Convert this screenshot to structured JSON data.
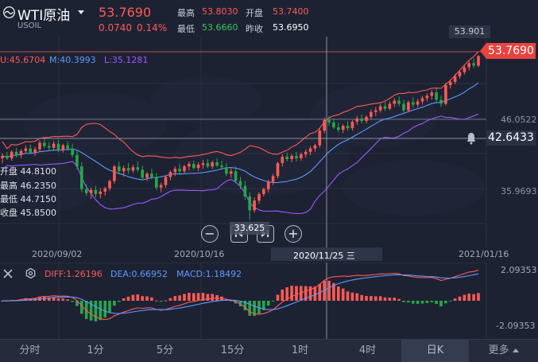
{
  "header": {
    "symbol": "WTI原油",
    "symbol_code": "USOIL",
    "last_price": "53.7690",
    "change": "0.0740",
    "change_pct": "0.14%",
    "high_label": "最高",
    "high_value": "53.8030",
    "open_label": "开盘",
    "open_value": "53.7400",
    "low_label": "最低",
    "low_value": "53.6660",
    "prev_close_label": "昨收",
    "prev_close_value": "53.6950"
  },
  "indicators": {
    "up": "U:45.6704",
    "mid": "M:40.3993",
    "low": "L:35.1281"
  },
  "ohlc_overlay": {
    "open": "开盘 44.8100",
    "high": "最高 46.2350",
    "low": "最低 44.7150",
    "close": "收盘 45.8500"
  },
  "price_axis": {
    "high_mark": "53.901",
    "current_price_tag": "53.7690",
    "level_1": "46.0522",
    "crosshair_value": "42.6433",
    "level_2": "35.9693",
    "low_mark": "33.625"
  },
  "x_axis": {
    "labels": [
      "2020/09/02",
      "2020/10/16",
      "2021/01/16"
    ],
    "crosshair_label": "2020/11/25 三"
  },
  "macd": {
    "diff": "DIFF:1.26196",
    "dea": "DEA:0.66952",
    "macd": "MACD:1.18492",
    "y_top": "2.09353",
    "y_bottom": "-2.09353"
  },
  "tabs": [
    "分时",
    "1分",
    "5分",
    "15分",
    "1时",
    "4时",
    "日K",
    "更多"
  ],
  "active_tab": "日K",
  "colors": {
    "up": "#ff5a55",
    "down": "#26a84a",
    "background": "#1d2233",
    "boll_mid": "#5b9bff",
    "boll_up": "#ff5a55",
    "boll_low": "#9b59ff"
  },
  "icons": {
    "symbol": "wave-icon",
    "close": "close-icon",
    "settings": "settings-icon",
    "alert": "bell-icon"
  },
  "chart_data": {
    "type": "candlestick",
    "price_range": [
      31.5,
      55.0
    ],
    "candles": [
      {
        "o": 41.2,
        "h": 41.8,
        "l": 40.6,
        "c": 41.5
      },
      {
        "o": 41.5,
        "h": 42.0,
        "l": 41.0,
        "c": 41.2
      },
      {
        "o": 41.2,
        "h": 42.2,
        "l": 40.9,
        "c": 42.0
      },
      {
        "o": 42.0,
        "h": 42.5,
        "l": 41.3,
        "c": 41.6
      },
      {
        "o": 41.6,
        "h": 42.3,
        "l": 41.2,
        "c": 42.1
      },
      {
        "o": 42.1,
        "h": 42.8,
        "l": 41.8,
        "c": 42.4
      },
      {
        "o": 42.4,
        "h": 42.9,
        "l": 41.7,
        "c": 41.9
      },
      {
        "o": 41.9,
        "h": 42.6,
        "l": 41.5,
        "c": 42.3
      },
      {
        "o": 42.3,
        "h": 43.4,
        "l": 42.0,
        "c": 43.1
      },
      {
        "o": 43.1,
        "h": 43.6,
        "l": 42.4,
        "c": 42.7
      },
      {
        "o": 42.7,
        "h": 43.2,
        "l": 42.1,
        "c": 42.5
      },
      {
        "o": 42.5,
        "h": 43.3,
        "l": 42.2,
        "c": 43.0
      },
      {
        "o": 43.0,
        "h": 43.5,
        "l": 42.0,
        "c": 42.2
      },
      {
        "o": 42.2,
        "h": 43.0,
        "l": 41.9,
        "c": 42.8
      },
      {
        "o": 42.8,
        "h": 43.3,
        "l": 42.1,
        "c": 42.4
      },
      {
        "o": 42.4,
        "h": 43.0,
        "l": 41.3,
        "c": 41.6
      },
      {
        "o": 41.6,
        "h": 42.1,
        "l": 39.8,
        "c": 40.2
      },
      {
        "o": 40.2,
        "h": 40.7,
        "l": 37.0,
        "c": 37.4
      },
      {
        "o": 37.4,
        "h": 38.0,
        "l": 36.6,
        "c": 36.9
      },
      {
        "o": 36.9,
        "h": 37.6,
        "l": 36.2,
        "c": 37.3
      },
      {
        "o": 37.3,
        "h": 37.8,
        "l": 36.4,
        "c": 36.8
      },
      {
        "o": 36.8,
        "h": 37.5,
        "l": 36.3,
        "c": 37.1
      },
      {
        "o": 37.1,
        "h": 37.7,
        "l": 36.6,
        "c": 37.5
      },
      {
        "o": 37.5,
        "h": 38.6,
        "l": 37.2,
        "c": 38.4
      },
      {
        "o": 38.4,
        "h": 40.4,
        "l": 38.1,
        "c": 40.2
      },
      {
        "o": 40.2,
        "h": 40.8,
        "l": 39.2,
        "c": 39.6
      },
      {
        "o": 39.6,
        "h": 40.3,
        "l": 38.9,
        "c": 40.0
      },
      {
        "o": 40.0,
        "h": 40.6,
        "l": 39.3,
        "c": 39.7
      },
      {
        "o": 39.7,
        "h": 40.4,
        "l": 39.4,
        "c": 40.1
      },
      {
        "o": 40.1,
        "h": 40.8,
        "l": 39.5,
        "c": 39.8
      },
      {
        "o": 39.8,
        "h": 40.3,
        "l": 38.5,
        "c": 38.8
      },
      {
        "o": 38.8,
        "h": 39.5,
        "l": 38.4,
        "c": 39.3
      },
      {
        "o": 39.3,
        "h": 39.9,
        "l": 38.6,
        "c": 38.9
      },
      {
        "o": 38.9,
        "h": 39.4,
        "l": 37.3,
        "c": 37.6
      },
      {
        "o": 37.6,
        "h": 38.2,
        "l": 37.0,
        "c": 37.9
      },
      {
        "o": 37.9,
        "h": 39.1,
        "l": 37.6,
        "c": 38.9
      },
      {
        "o": 38.9,
        "h": 39.7,
        "l": 38.5,
        "c": 39.5
      },
      {
        "o": 39.5,
        "h": 40.2,
        "l": 39.0,
        "c": 39.9
      },
      {
        "o": 39.9,
        "h": 40.5,
        "l": 39.3,
        "c": 39.6
      },
      {
        "o": 39.6,
        "h": 40.4,
        "l": 39.4,
        "c": 40.2
      },
      {
        "o": 40.2,
        "h": 40.8,
        "l": 39.7,
        "c": 40.5
      },
      {
        "o": 40.5,
        "h": 40.9,
        "l": 39.8,
        "c": 40.0
      },
      {
        "o": 40.0,
        "h": 40.7,
        "l": 39.6,
        "c": 40.4
      },
      {
        "o": 40.4,
        "h": 41.0,
        "l": 39.9,
        "c": 40.6
      },
      {
        "o": 40.6,
        "h": 41.1,
        "l": 40.0,
        "c": 40.2
      },
      {
        "o": 40.2,
        "h": 40.9,
        "l": 39.9,
        "c": 40.7
      },
      {
        "o": 40.7,
        "h": 41.2,
        "l": 40.1,
        "c": 40.3
      },
      {
        "o": 40.3,
        "h": 40.9,
        "l": 39.8,
        "c": 40.1
      },
      {
        "o": 40.1,
        "h": 40.6,
        "l": 39.0,
        "c": 39.3
      },
      {
        "o": 39.3,
        "h": 40.0,
        "l": 38.8,
        "c": 39.6
      },
      {
        "o": 39.6,
        "h": 40.2,
        "l": 38.1,
        "c": 38.4
      },
      {
        "o": 38.4,
        "h": 38.9,
        "l": 37.4,
        "c": 37.8
      },
      {
        "o": 37.8,
        "h": 38.4,
        "l": 36.1,
        "c": 36.5
      },
      {
        "o": 36.5,
        "h": 37.0,
        "l": 33.6,
        "c": 34.8
      },
      {
        "o": 34.8,
        "h": 36.4,
        "l": 34.5,
        "c": 36.0
      },
      {
        "o": 36.0,
        "h": 37.0,
        "l": 35.6,
        "c": 36.8
      },
      {
        "o": 36.8,
        "h": 37.6,
        "l": 36.5,
        "c": 37.4
      },
      {
        "o": 37.4,
        "h": 38.6,
        "l": 37.0,
        "c": 38.3
      },
      {
        "o": 38.3,
        "h": 39.3,
        "l": 37.9,
        "c": 39.0
      },
      {
        "o": 39.0,
        "h": 40.8,
        "l": 38.7,
        "c": 40.6
      },
      {
        "o": 40.6,
        "h": 41.7,
        "l": 40.2,
        "c": 41.4
      },
      {
        "o": 41.4,
        "h": 41.9,
        "l": 40.8,
        "c": 41.1
      },
      {
        "o": 41.1,
        "h": 41.7,
        "l": 40.7,
        "c": 41.5
      },
      {
        "o": 41.5,
        "h": 42.0,
        "l": 40.8,
        "c": 41.2
      },
      {
        "o": 41.2,
        "h": 41.9,
        "l": 40.9,
        "c": 41.7
      },
      {
        "o": 41.7,
        "h": 42.3,
        "l": 41.3,
        "c": 42.0
      },
      {
        "o": 42.0,
        "h": 42.7,
        "l": 41.6,
        "c": 42.4
      },
      {
        "o": 42.4,
        "h": 43.0,
        "l": 42.0,
        "c": 42.8
      },
      {
        "o": 42.8,
        "h": 44.9,
        "l": 42.5,
        "c": 44.6
      },
      {
        "o": 44.6,
        "h": 46.2,
        "l": 44.3,
        "c": 45.9
      },
      {
        "o": 45.9,
        "h": 46.4,
        "l": 45.2,
        "c": 45.6
      },
      {
        "o": 45.6,
        "h": 46.1,
        "l": 44.8,
        "c": 45.0
      },
      {
        "o": 45.0,
        "h": 45.6,
        "l": 44.4,
        "c": 44.7
      },
      {
        "o": 44.7,
        "h": 45.4,
        "l": 44.3,
        "c": 45.2
      },
      {
        "o": 45.2,
        "h": 45.8,
        "l": 44.6,
        "c": 44.9
      },
      {
        "o": 44.9,
        "h": 45.9,
        "l": 44.6,
        "c": 45.7
      },
      {
        "o": 45.7,
        "h": 46.4,
        "l": 45.3,
        "c": 46.1
      },
      {
        "o": 46.1,
        "h": 46.6,
        "l": 45.5,
        "c": 45.8
      },
      {
        "o": 45.8,
        "h": 46.5,
        "l": 45.5,
        "c": 46.3
      },
      {
        "o": 46.3,
        "h": 47.2,
        "l": 46.0,
        "c": 46.9
      },
      {
        "o": 46.9,
        "h": 47.5,
        "l": 46.4,
        "c": 47.1
      },
      {
        "o": 47.1,
        "h": 47.9,
        "l": 46.8,
        "c": 47.6
      },
      {
        "o": 47.6,
        "h": 48.1,
        "l": 47.0,
        "c": 47.3
      },
      {
        "o": 47.3,
        "h": 48.2,
        "l": 47.1,
        "c": 47.9
      },
      {
        "o": 47.9,
        "h": 48.6,
        "l": 47.5,
        "c": 48.3
      },
      {
        "o": 48.3,
        "h": 48.8,
        "l": 47.6,
        "c": 47.9
      },
      {
        "o": 47.9,
        "h": 48.4,
        "l": 46.8,
        "c": 47.1
      },
      {
        "o": 47.1,
        "h": 48.3,
        "l": 46.9,
        "c": 48.1
      },
      {
        "o": 48.1,
        "h": 48.7,
        "l": 47.4,
        "c": 47.8
      },
      {
        "o": 47.8,
        "h": 48.5,
        "l": 47.5,
        "c": 48.2
      },
      {
        "o": 48.2,
        "h": 48.9,
        "l": 47.8,
        "c": 48.6
      },
      {
        "o": 48.6,
        "h": 49.2,
        "l": 48.2,
        "c": 48.9
      },
      {
        "o": 48.9,
        "h": 49.6,
        "l": 48.4,
        "c": 49.3
      },
      {
        "o": 49.3,
        "h": 49.8,
        "l": 48.1,
        "c": 48.4
      },
      {
        "o": 48.4,
        "h": 48.9,
        "l": 47.5,
        "c": 47.9
      },
      {
        "o": 47.9,
        "h": 50.5,
        "l": 47.7,
        "c": 50.2
      },
      {
        "o": 50.2,
        "h": 50.9,
        "l": 49.8,
        "c": 50.6
      },
      {
        "o": 50.6,
        "h": 51.6,
        "l": 50.3,
        "c": 51.3
      },
      {
        "o": 51.3,
        "h": 52.1,
        "l": 51.0,
        "c": 51.8
      },
      {
        "o": 51.8,
        "h": 52.7,
        "l": 51.5,
        "c": 52.4
      },
      {
        "o": 52.4,
        "h": 53.2,
        "l": 52.0,
        "c": 52.9
      },
      {
        "o": 52.9,
        "h": 53.5,
        "l": 52.3,
        "c": 52.6
      },
      {
        "o": 52.6,
        "h": 53.9,
        "l": 52.4,
        "c": 53.77
      }
    ]
  }
}
